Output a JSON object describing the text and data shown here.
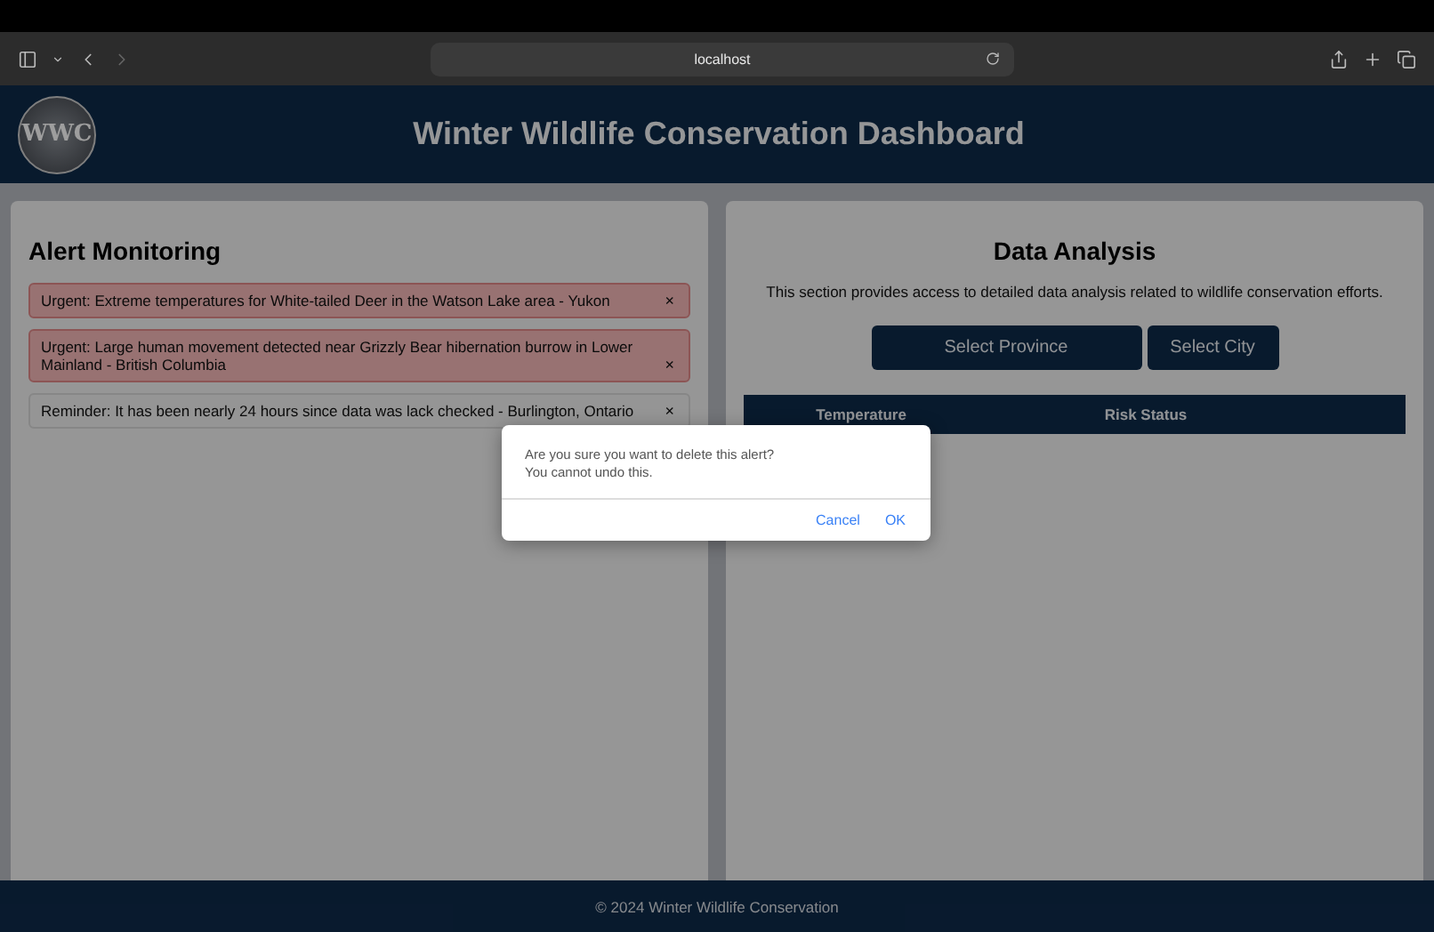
{
  "browser": {
    "url": "localhost"
  },
  "header": {
    "logo_text": "WWC",
    "title": "Winter Wildlife Conservation Dashboard"
  },
  "alerts_panel": {
    "title": "Alert Monitoring",
    "alerts": [
      {
        "kind": "urgent",
        "text": "Urgent: Extreme temperatures for White-tailed Deer in the Watson Lake area - Yukon",
        "close": "×"
      },
      {
        "kind": "urgent",
        "text": "Urgent: Large human movement detected near Grizzly Bear hibernation burrow in Lower Mainland - British Columbia",
        "close": "×"
      },
      {
        "kind": "reminder",
        "text": "Reminder: It has been nearly 24 hours since data was lack checked - Burlington, Ontario",
        "close": "×"
      }
    ]
  },
  "analysis_panel": {
    "title": "Data Analysis",
    "description": "This section provides access to detailed data analysis related to wildlife conservation efforts.",
    "buttons": [
      "Select Province",
      "Select City"
    ],
    "table": {
      "columns": [
        "Temperature",
        "Risk Status"
      ]
    }
  },
  "dialog": {
    "message": [
      "Are you sure you want to delete this alert?",
      "You cannot undo this."
    ],
    "buttons": [
      "Cancel",
      "OK"
    ]
  },
  "footer": "© 2024 Winter Wildlife Conservation"
}
